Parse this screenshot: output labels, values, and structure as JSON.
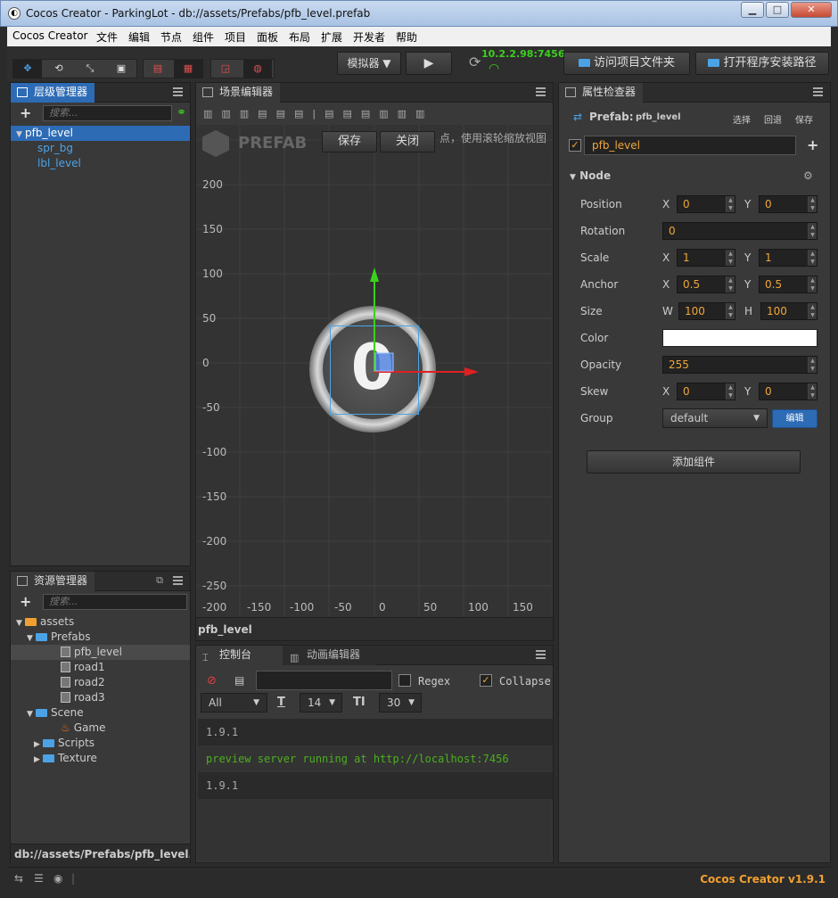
{
  "window": {
    "title": "Cocos Creator - ParkingLot - db://assets/Prefabs/pfb_level.prefab",
    "min": "▁",
    "max": "□",
    "close": "✕"
  },
  "menu": [
    "Cocos Creator",
    "文件",
    "编辑",
    "节点",
    "组件",
    "项目",
    "面板",
    "布局",
    "扩展",
    "开发者",
    "帮助"
  ],
  "toolbar": {
    "simulator_label": "模拟器 ▼",
    "play_icon": "▶",
    "refresh_icon": "⟳",
    "ip_address": "10.2.2.98:7456",
    "open_project_folder": "访问项目文件夹",
    "open_install_path": "打开程序安装路径"
  },
  "hierarchy": {
    "title": "层级管理器",
    "search_placeholder": "搜索...",
    "items": [
      {
        "label": "pfb_level"
      },
      {
        "label": "spr_bg"
      },
      {
        "label": "lbl_level"
      }
    ]
  },
  "assets": {
    "title": "资源管理器",
    "search_placeholder": "搜索...",
    "root": "assets",
    "prefabs_folder": "Prefabs",
    "prefabs": [
      "pfb_level",
      "road1",
      "road2",
      "road3"
    ],
    "scene_folder": "Scene",
    "scene_items": [
      "Game"
    ],
    "scripts_folder": "Scripts",
    "texture_folder": "Texture",
    "footer_path": "db://assets/Prefabs/pfb_level.pr..."
  },
  "scene": {
    "title": "场景编辑器",
    "prefab_badge": "PREFAB",
    "save_button": "保存",
    "close_button": "关闭",
    "hint": "点，使用滚轮缩放视图",
    "node_digit": "0",
    "y_ticks": [
      "200",
      "150",
      "100",
      "50",
      "0",
      "-50",
      "-100",
      "-150",
      "-200",
      "-250"
    ],
    "x_ticks": [
      "-200",
      "-150",
      "-100",
      "-50",
      "0",
      "50",
      "100",
      "150"
    ],
    "node_name": "pfb_level"
  },
  "console": {
    "tab_console": "控制台",
    "tab_animation": "动画编辑器",
    "regex_label": "Regex",
    "collapse_label": "Collapse",
    "filter_value": "All",
    "font_size_value": "14",
    "line_height_value": "30",
    "logs": [
      {
        "text": "1.9.1",
        "color": "#aaaaaa"
      },
      {
        "text": "preview server running at http://localhost:7456",
        "color": "#4caf1f"
      },
      {
        "text": "1.9.1",
        "color": "#aaaaaa"
      }
    ]
  },
  "inspector": {
    "title": "属性检查器",
    "prefab_label": "Prefab:",
    "prefab_name": "pfb_level",
    "select_btn": "选择",
    "revert_btn": "回退",
    "save_btn": "保存",
    "node_name": "pfb_level",
    "section_node": "Node",
    "position_label": "Position",
    "position_x": "0",
    "position_y": "0",
    "rotation_label": "Rotation",
    "rotation": "0",
    "scale_label": "Scale",
    "scale_x": "1",
    "scale_y": "1",
    "anchor_label": "Anchor",
    "anchor_x": "0.5",
    "anchor_y": "0.5",
    "size_label": "Size",
    "size_w": "100",
    "size_h": "100",
    "color_label": "Color",
    "color_value": "#ffffff",
    "opacity_label": "Opacity",
    "opacity": "255",
    "skew_label": "Skew",
    "skew_x": "0",
    "skew_y": "0",
    "group_label": "Group",
    "group_value": "default",
    "group_edit_btn": "编辑",
    "add_component": "添加组件",
    "axis_x": "X",
    "axis_y": "Y",
    "axis_w": "W",
    "axis_h": "H"
  },
  "statusbar": {
    "version": "Cocos Creator v1.9.1"
  },
  "colors": {
    "accent": "#2d6bb5",
    "value_orange": "#f0a63a",
    "link_blue": "#4ba3e6",
    "version_orange": "#f0a030"
  }
}
